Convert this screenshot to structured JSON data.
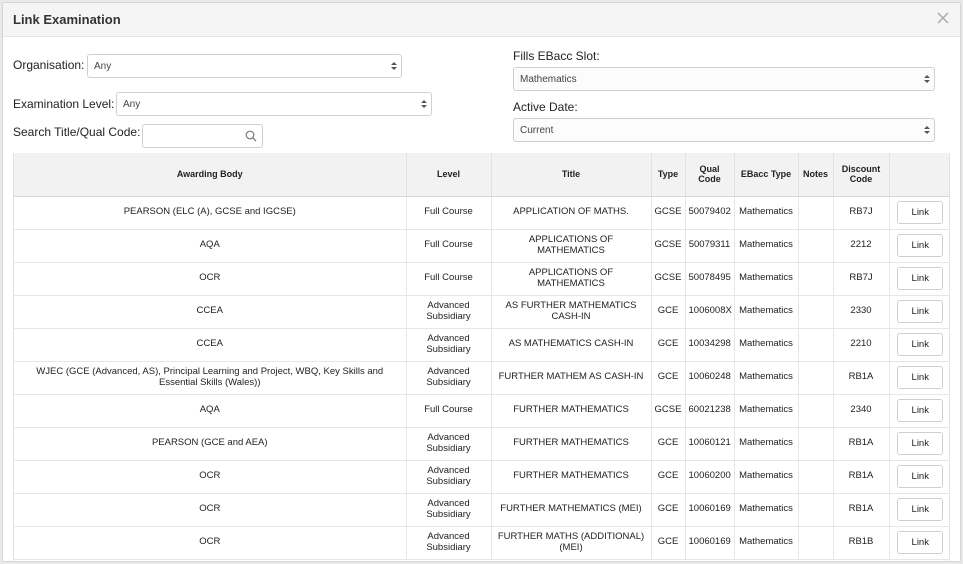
{
  "dialog": {
    "title": "Link Examination"
  },
  "filters": {
    "organisation_label": "Organisation:",
    "organisation_value": "Any",
    "level_label": "Examination Level:",
    "level_value": "Any",
    "search_label": "Search Title/Qual Code:",
    "search_value": "",
    "ebacc_label": "Fills EBacc Slot:",
    "ebacc_value": "Mathematics",
    "active_label": "Active Date:",
    "active_value": "Current"
  },
  "table": {
    "headers": [
      "Awarding Body",
      "Level",
      "Title",
      "Type",
      "Qual Code",
      "EBacc Type",
      "Notes",
      "Discount Code",
      ""
    ],
    "link_label": "Link",
    "rows": [
      [
        "PEARSON (ELC (A), GCSE and IGCSE)",
        "Full Course",
        "APPLICATION OF MATHS.",
        "GCSE",
        "50079402",
        "Mathematics",
        "",
        "RB7J"
      ],
      [
        "AQA",
        "Full Course",
        "APPLICATIONS OF MATHEMATICS",
        "GCSE",
        "50079311",
        "Mathematics",
        "",
        "2212"
      ],
      [
        "OCR",
        "Full Course",
        "APPLICATIONS OF MATHEMATICS",
        "GCSE",
        "50078495",
        "Mathematics",
        "",
        "RB7J"
      ],
      [
        "CCEA",
        "Advanced Subsidiary",
        "AS FURTHER MATHEMATICS CASH-IN",
        "GCE",
        "1006008X",
        "Mathematics",
        "",
        "2330"
      ],
      [
        "CCEA",
        "Advanced Subsidiary",
        "AS MATHEMATICS CASH-IN",
        "GCE",
        "10034298",
        "Mathematics",
        "",
        "2210"
      ],
      [
        "WJEC (GCE (Advanced, AS), Principal Learning and Project, WBQ, Key Skills and Essential Skills (Wales))",
        "Advanced Subsidiary",
        "FURTHER MATHEM AS CASH-IN",
        "GCE",
        "10060248",
        "Mathematics",
        "",
        "RB1A"
      ],
      [
        "AQA",
        "Full Course",
        "FURTHER MATHEMATICS",
        "GCSE",
        "60021238",
        "Mathematics",
        "",
        "2340"
      ],
      [
        "PEARSON (GCE and AEA)",
        "Advanced Subsidiary",
        "FURTHER MATHEMATICS",
        "GCE",
        "10060121",
        "Mathematics",
        "",
        "RB1A"
      ],
      [
        "OCR",
        "Advanced Subsidiary",
        "FURTHER MATHEMATICS",
        "GCE",
        "10060200",
        "Mathematics",
        "",
        "RB1A"
      ],
      [
        "OCR",
        "Advanced Subsidiary",
        "FURTHER MATHEMATICS (MEI)",
        "GCE",
        "10060169",
        "Mathematics",
        "",
        "RB1A"
      ],
      [
        "OCR",
        "Advanced Subsidiary",
        "FURTHER MATHS (ADDITIONAL) (MEI)",
        "GCE",
        "10060169",
        "Mathematics",
        "",
        "RB1B"
      ]
    ]
  }
}
